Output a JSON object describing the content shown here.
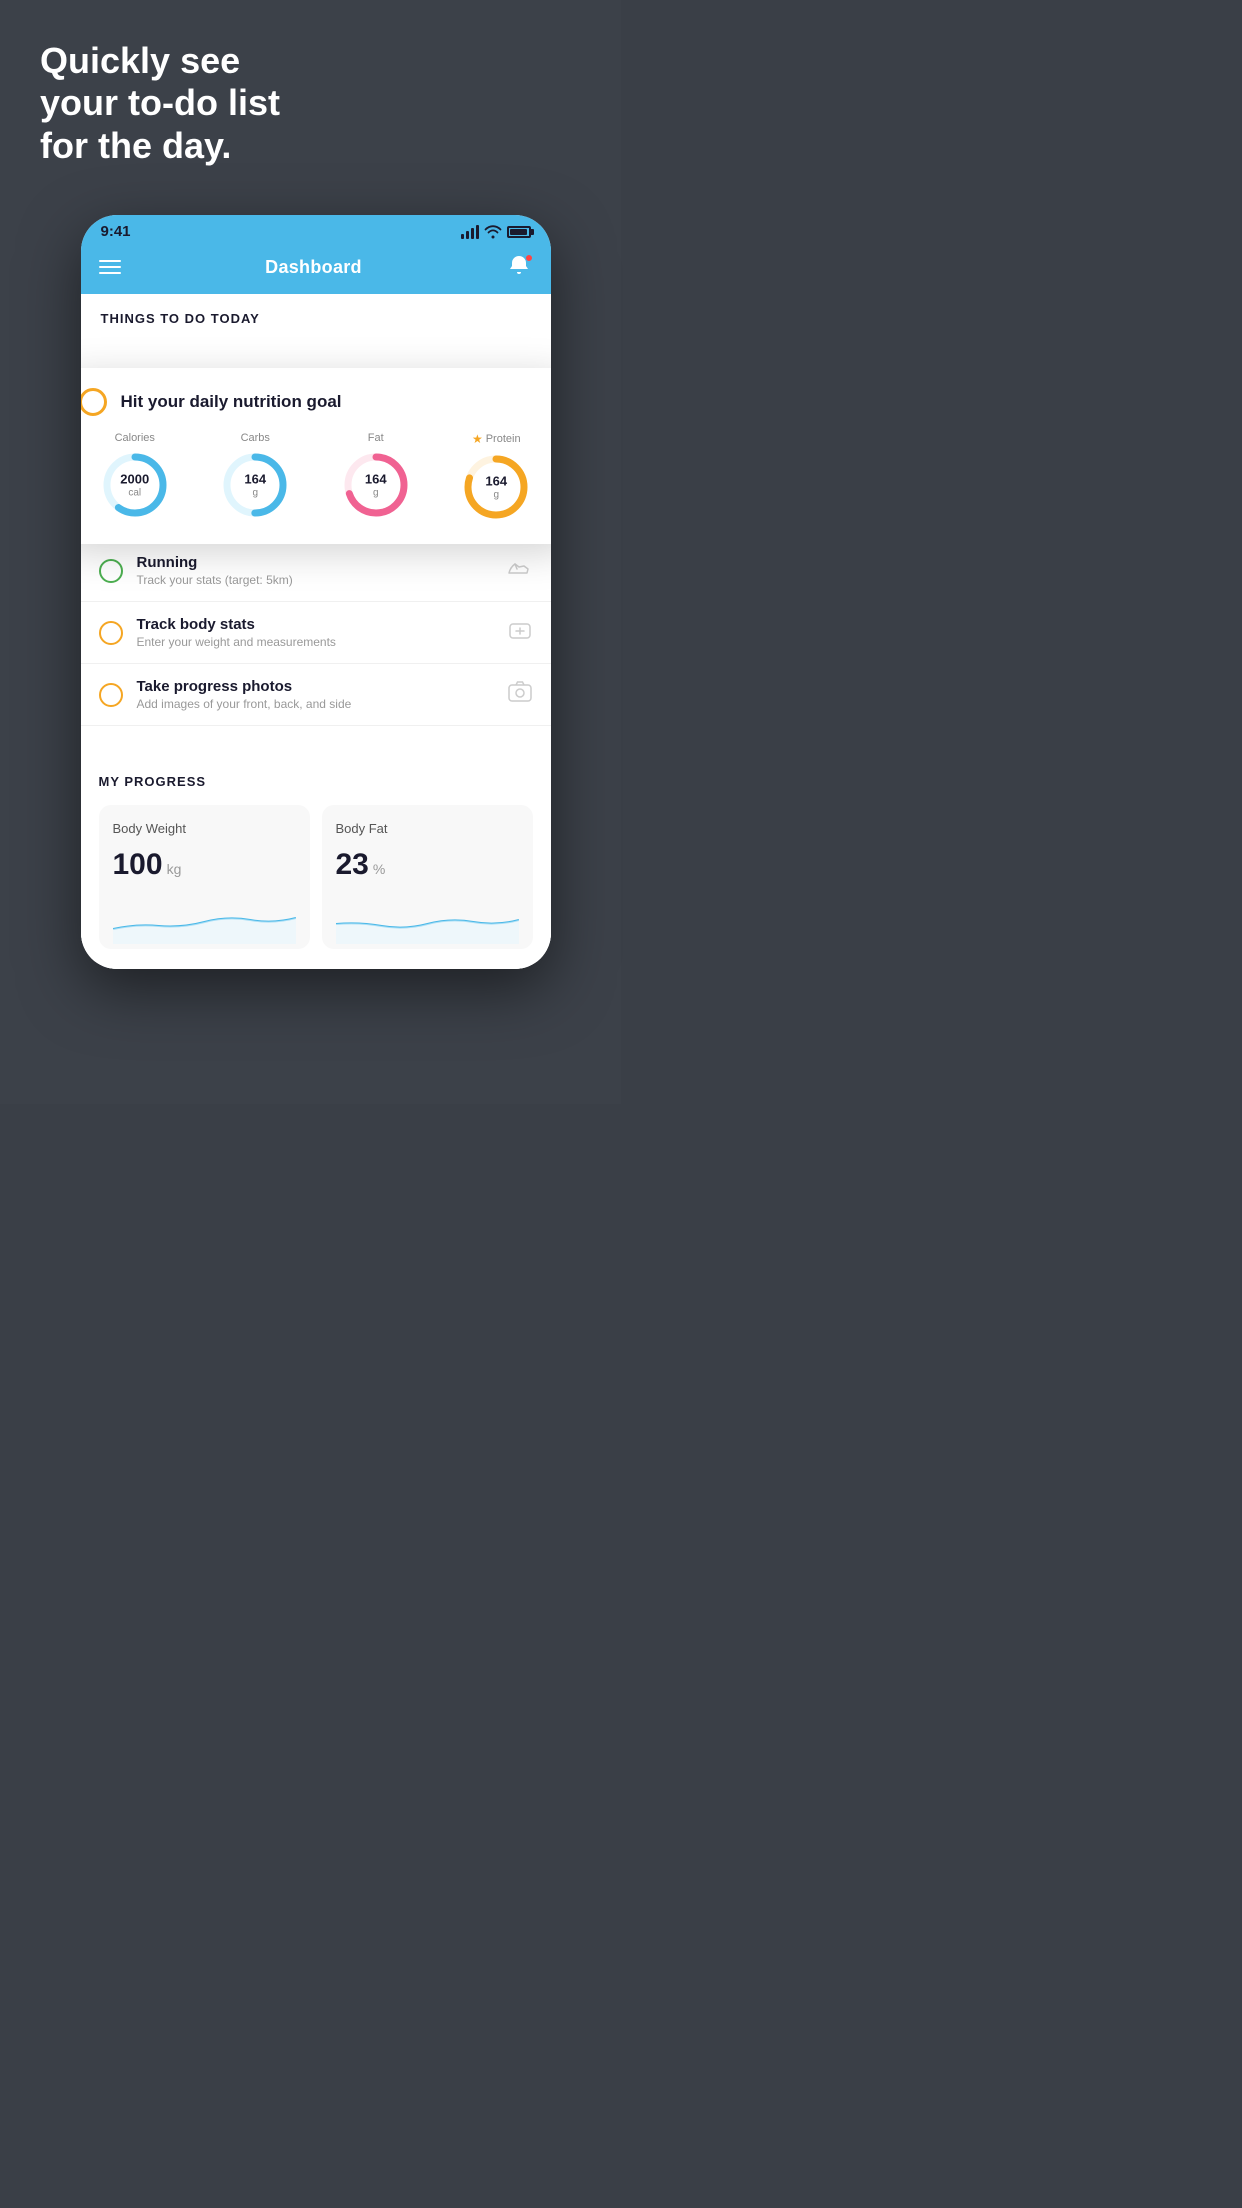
{
  "headline": "Quickly see\nyour to-do list\nfor the day.",
  "statusBar": {
    "time": "9:41",
    "signal": "signal-icon",
    "wifi": "wifi-icon",
    "battery": "battery-icon"
  },
  "navbar": {
    "menu": "menu-icon",
    "title": "Dashboard",
    "bell": "bell-icon"
  },
  "thingsToDo": {
    "sectionTitle": "THINGS TO DO TODAY"
  },
  "nutritionCard": {
    "circleCheck": "circle-check-icon",
    "title": "Hit your daily nutrition goal",
    "items": [
      {
        "label": "Calories",
        "value": "2000",
        "unit": "cal",
        "color": "#4ab8e8",
        "trackColor": "#e0f5fd",
        "progress": 0.6,
        "starred": false
      },
      {
        "label": "Carbs",
        "value": "164",
        "unit": "g",
        "color": "#4ab8e8",
        "trackColor": "#e0f5fd",
        "progress": 0.5,
        "starred": false
      },
      {
        "label": "Fat",
        "value": "164",
        "unit": "g",
        "color": "#f06292",
        "trackColor": "#fde8ef",
        "progress": 0.7,
        "starred": false
      },
      {
        "label": "Protein",
        "value": "164",
        "unit": "g",
        "color": "#f5a623",
        "trackColor": "#fef3e0",
        "progress": 0.8,
        "starred": true
      }
    ]
  },
  "todoItems": [
    {
      "circleType": "green",
      "main": "Running",
      "sub": "Track your stats (target: 5km)",
      "icon": "shoe-icon"
    },
    {
      "circleType": "yellow",
      "main": "Track body stats",
      "sub": "Enter your weight and measurements",
      "icon": "scale-icon"
    },
    {
      "circleType": "yellow",
      "main": "Take progress photos",
      "sub": "Add images of your front, back, and side",
      "icon": "photo-icon"
    }
  ],
  "progressSection": {
    "title": "MY PROGRESS",
    "cards": [
      {
        "title": "Body Weight",
        "value": "100",
        "unit": "kg"
      },
      {
        "title": "Body Fat",
        "value": "23",
        "unit": "%"
      }
    ]
  }
}
